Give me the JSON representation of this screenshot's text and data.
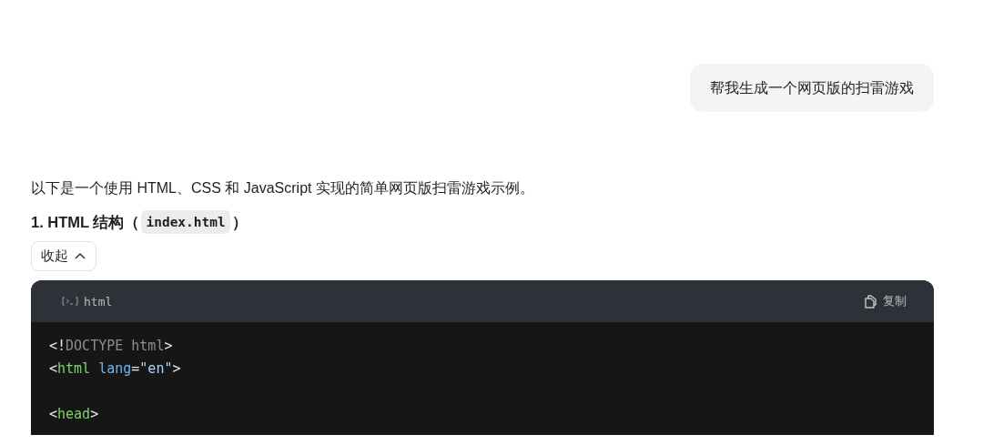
{
  "user_message": {
    "text": "帮我生成一个网页版的扫雷游戏"
  },
  "reply": {
    "intro": "以下是一个使用 HTML、CSS 和 JavaScript 实现的简单网页版扫雷游戏示例。",
    "heading": {
      "text": "1. HTML 结构（",
      "code": "index.html",
      "after": "）"
    },
    "collapse_button": {
      "label": "收起",
      "expanded": true
    },
    "code_block": {
      "language": "html",
      "copy_label": "复制",
      "groups": [
        [
          {
            "tokens": [
              {
                "kind": "punct",
                "text": "<!"
              },
              {
                "kind": "doctype",
                "text": "DOCTYPE html"
              },
              {
                "kind": "punct",
                "text": ">"
              }
            ]
          },
          {
            "tokens": [
              {
                "kind": "punct",
                "text": "<"
              },
              {
                "kind": "tag",
                "text": "html"
              },
              {
                "kind": "attr",
                "text": "lang"
              },
              {
                "kind": "punct",
                "text": "="
              },
              {
                "kind": "string",
                "text": "\"en\""
              },
              {
                "kind": "punct",
                "text": ">"
              }
            ]
          }
        ],
        [
          {
            "tokens": [
              {
                "kind": "punct",
                "text": "<"
              },
              {
                "kind": "tag",
                "text": "head"
              },
              {
                "kind": "punct",
                "text": ">"
              }
            ]
          }
        ]
      ]
    }
  }
}
